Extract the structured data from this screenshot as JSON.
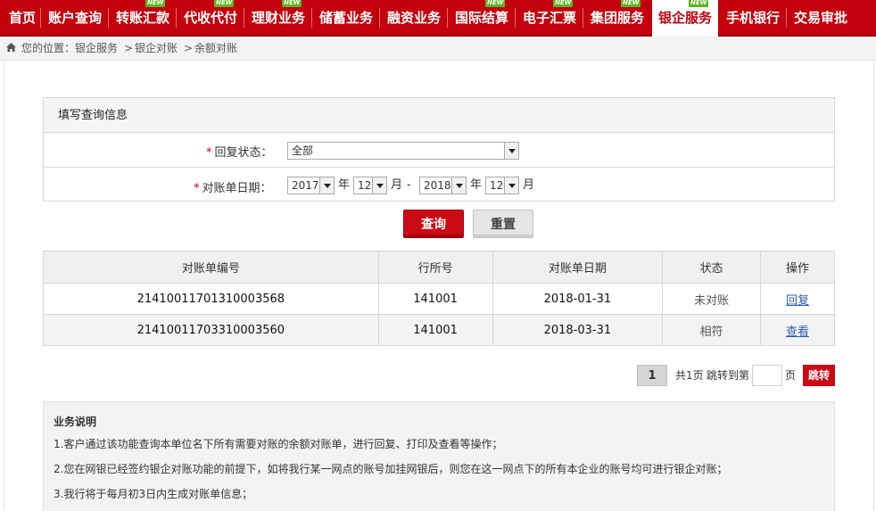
{
  "nav": {
    "items": [
      {
        "label": "首页",
        "new": false
      },
      {
        "label": "账户查询",
        "new": false
      },
      {
        "label": "转账汇款",
        "new": true
      },
      {
        "label": "代收代付",
        "new": true
      },
      {
        "label": "理财业务",
        "new": true
      },
      {
        "label": "储蓄业务",
        "new": false
      },
      {
        "label": "融资业务",
        "new": false
      },
      {
        "label": "国际结算",
        "new": true
      },
      {
        "label": "电子汇票",
        "new": true
      },
      {
        "label": "集团服务",
        "new": true
      },
      {
        "label": "银企服务",
        "new": true,
        "active": true
      },
      {
        "label": "手机银行",
        "new": false
      },
      {
        "label": "交易审批",
        "new": false
      }
    ],
    "new_badge": "NEW"
  },
  "breadcrumb": {
    "prefix": "您的位置：",
    "parts": [
      "银企服务",
      "银企对账",
      "余额对账"
    ],
    "separator": ">"
  },
  "form": {
    "title": "填写查询信息",
    "required_mark": "*",
    "status_label": "回复状态：",
    "status_value": "全部",
    "date_label": "对账单日期：",
    "start_year": "2017",
    "start_month": "12",
    "end_year": "2018",
    "end_month": "12",
    "year_unit": "年",
    "month_unit": "月",
    "range_dash": "-"
  },
  "buttons": {
    "query": "查询",
    "reset": "重置"
  },
  "table": {
    "headers": [
      "对账单编号",
      "行所号",
      "对账单日期",
      "状态",
      "操作"
    ],
    "rows": [
      {
        "id": "21410011701310003568",
        "branch": "141001",
        "date": "2018-01-31",
        "status": "未对账",
        "action": "回复"
      },
      {
        "id": "21410011703310003560",
        "branch": "141001",
        "date": "2018-03-31",
        "status": "相符",
        "action": "查看"
      }
    ]
  },
  "pagination": {
    "current": "1",
    "total_text": "共1页",
    "jump_prefix": "跳转到第",
    "jump_suffix": "页",
    "go": "跳转"
  },
  "notes": {
    "title": "业务说明",
    "items": [
      "1.客户通过该功能查询本单位名下所有需要对账的余额对账单，进行回复、打印及查看等操作；",
      "2.您在网银已经签约银企对账功能的前提下，如将我行某一网点的账号加挂网银后，则您在这一网点下的所有本企业的账号均可进行银企对账；",
      "3.我行将于每月初3日内生成对账单信息；"
    ]
  },
  "colors": {
    "brand_red": "#c4000d",
    "new_green": "#57b91a",
    "link_blue": "#2f5fb3"
  },
  "icons": {
    "home": "home-icon",
    "dropdown": "chevron-down-icon"
  }
}
